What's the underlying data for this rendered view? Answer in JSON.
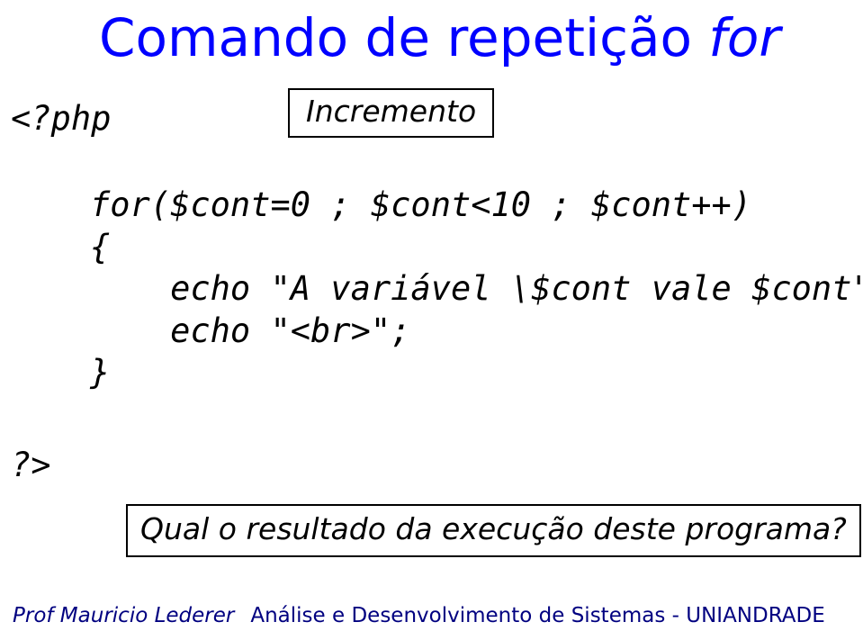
{
  "title": {
    "prefix": "Comando de repetição ",
    "keyword": "for"
  },
  "code": {
    "open": "<?php",
    "line1": "for($cont=0 ; $cont<10 ; $cont++)",
    "line2": "{",
    "line3": "    echo \"A variável \\$cont vale $cont\";",
    "line4": "    echo \"<br>\";",
    "line5": "}",
    "close": "?>"
  },
  "label": "Incremento",
  "question": "Qual o resultado da execução deste programa?",
  "footer": {
    "author": "Prof Mauricio Lederer",
    "credit": "Análise e Desenvolvimento de Sistemas - UNIANDRADE"
  }
}
